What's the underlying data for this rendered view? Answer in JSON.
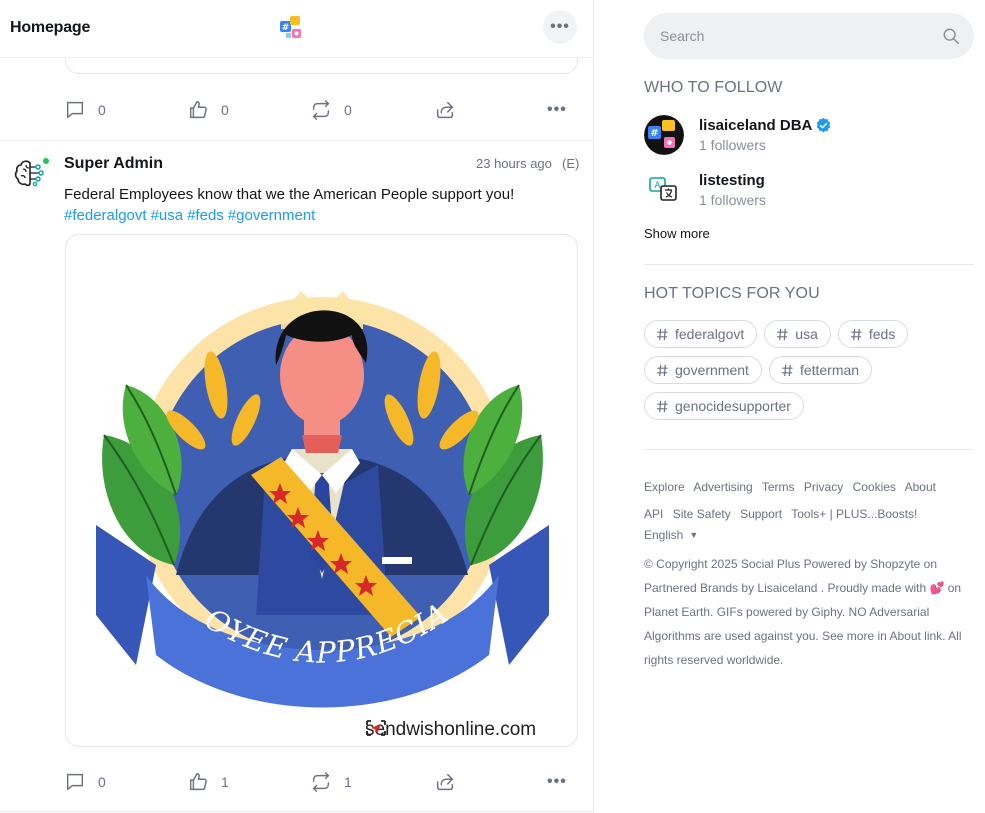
{
  "header": {
    "title": "Homepage",
    "more_label": "•••"
  },
  "prev_post": {
    "actions": {
      "comments": "0",
      "likes": "0",
      "reposts": "0",
      "more": "•••"
    }
  },
  "post": {
    "author": "Super Admin",
    "time": "23 hours ago",
    "edited": "(E)",
    "text": "Federal Employees know that we the American People support you!",
    "tags": [
      "#federalgovt",
      "#usa",
      "#feds",
      "#government"
    ],
    "image": {
      "banner_text": "EMPLOYEE APPRECIATION",
      "watermark": "sendwishonline.com"
    },
    "actions": {
      "comments": "0",
      "likes": "1",
      "reposts": "1",
      "more": "•••"
    }
  },
  "sidebar": {
    "search": {
      "placeholder": "Search",
      "value": ""
    },
    "who_to_follow": {
      "title": "WHO TO FOLLOW",
      "items": [
        {
          "name": "lisaiceland DBA",
          "sub": "1 followers",
          "verified": true
        },
        {
          "name": "listesting",
          "sub": "1 followers",
          "verified": false
        }
      ],
      "show_more": "Show more"
    },
    "hot_topics": {
      "title": "HOT TOPICS FOR YOU",
      "chips": [
        "federalgovt",
        "usa",
        "feds",
        "government",
        "fetterman",
        "genocidesupporter"
      ]
    },
    "footer": {
      "links": [
        "Explore",
        "Advertising",
        "Terms",
        "Privacy",
        "Cookies",
        "About",
        "API",
        "Site Safety",
        "Support",
        "Tools+ | PLUS...Boosts!"
      ],
      "language": "English",
      "copyright": "© Copyright 2025 Social Plus Powered by Shopzyte on Partnered Brands by Lisaiceland . Proudly made with 💕 on Planet Earth. GIFs powered by Giphy. NO Adversarial Algorithms are used against you. See more in About link. All rights reserved worldwide."
    }
  },
  "colors": {
    "accent": "#1d9bf0",
    "online": "#22c55e",
    "verified": "#1d9bf0"
  },
  "icons": {
    "logo": "social-plus-logo-icon",
    "comment": "comment-icon",
    "like": "thumbs-up-icon",
    "repost": "repost-icon",
    "share": "share-icon",
    "search": "search-icon",
    "hash": "hash-icon",
    "verified": "verified-badge-icon"
  }
}
